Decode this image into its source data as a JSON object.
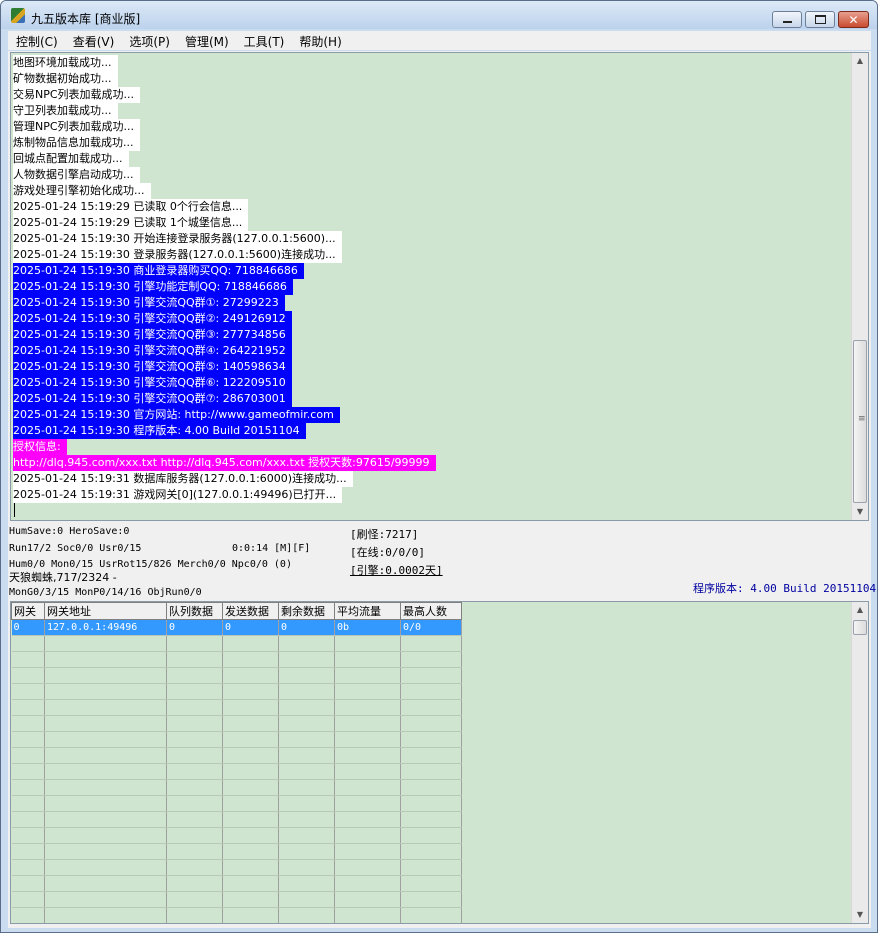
{
  "window": {
    "title": "九五版本库 [商业版]"
  },
  "menu": [
    "控制(C)",
    "查看(V)",
    "选项(P)",
    "管理(M)",
    "工具(T)",
    "帮助(H)"
  ],
  "log": [
    {
      "style": "normal",
      "text": "地图环境加载成功..."
    },
    {
      "style": "normal",
      "text": "矿物数据初始成功..."
    },
    {
      "style": "normal",
      "text": "交易NPC列表加载成功..."
    },
    {
      "style": "normal",
      "text": "守卫列表加载成功..."
    },
    {
      "style": "normal",
      "text": "管理NPC列表加载成功..."
    },
    {
      "style": "normal",
      "text": "炼制物品信息加载成功..."
    },
    {
      "style": "normal",
      "text": "回城点配置加载成功..."
    },
    {
      "style": "normal",
      "text": "人物数据引擎启动成功..."
    },
    {
      "style": "normal",
      "text": "游戏处理引擎初始化成功..."
    },
    {
      "style": "normal",
      "text": "2025-01-24 15:19:29 已读取 0个行会信息..."
    },
    {
      "style": "normal",
      "text": "2025-01-24 15:19:29 已读取 1个城堡信息..."
    },
    {
      "style": "normal",
      "text": "2025-01-24 15:19:30 开始连接登录服务器(127.0.0.1:5600)..."
    },
    {
      "style": "normal",
      "text": "2025-01-24 15:19:30 登录服务器(127.0.0.1:5600)连接成功..."
    },
    {
      "style": "blue",
      "text": "2025-01-24 15:19:30 商业登录器购买QQ: 718846686"
    },
    {
      "style": "blue",
      "text": "2025-01-24 15:19:30 引擎功能定制QQ: 718846686"
    },
    {
      "style": "blue",
      "text": "2025-01-24 15:19:30 引擎交流QQ群①: 27299223"
    },
    {
      "style": "blue",
      "text": "2025-01-24 15:19:30 引擎交流QQ群②: 249126912"
    },
    {
      "style": "blue",
      "text": "2025-01-24 15:19:30 引擎交流QQ群③: 277734856"
    },
    {
      "style": "blue",
      "text": "2025-01-24 15:19:30 引擎交流QQ群④: 264221952"
    },
    {
      "style": "blue",
      "text": "2025-01-24 15:19:30 引擎交流QQ群⑤: 140598634"
    },
    {
      "style": "blue",
      "text": "2025-01-24 15:19:30 引擎交流QQ群⑥: 122209510"
    },
    {
      "style": "blue",
      "text": "2025-01-24 15:19:30 引擎交流QQ群⑦: 286703001"
    },
    {
      "style": "blue",
      "text": "2025-01-24 15:19:30 官方网站: http://www.gameofmir.com"
    },
    {
      "style": "blue",
      "text": "2025-01-24 15:19:30 程序版本: 4.00 Build 20151104"
    },
    {
      "style": "magenta",
      "text": "授权信息:"
    },
    {
      "style": "magenta",
      "text": "http://dlq.945.com/xxx.txt http://dlq.945.com/xxx.txt 授权天数:97615/99999"
    },
    {
      "style": "normal",
      "text": "2025-01-24 15:19:31 数据库服务器(127.0.0.1:6000)连接成功..."
    },
    {
      "style": "normal",
      "text": "2025-01-24 15:19:31 游戏网关[0](127.0.0.1:49496)已打开..."
    }
  ],
  "status": {
    "hum_save": "HumSave:0 HeroSave:0",
    "run": "Run17/2 Soc0/0 Usr0/15",
    "time": "0:0:14 [M][F]",
    "mon": "Hum0/0 Mon0/15 UsrRot15/826 Merch0/0 Npc0/0 (0)",
    "spider": "天狼蜘蛛,717/2324 -",
    "mong": "MonG0/3/15 MonP0/14/16 ObjRun0/0",
    "refresh": "[刷怪:7217]",
    "online": "[在线:0/0/0]",
    "engine": "[引擎:0.0002天]",
    "version": "程序版本: 4.00 Build 20151104"
  },
  "gateway_table": {
    "headers": [
      "网关",
      "网关地址",
      "队列数据",
      "发送数据",
      "剩余数据",
      "平均流量",
      "最高人数"
    ],
    "rows": [
      [
        "0",
        "127.0.0.1:49496",
        "0",
        "0",
        "0",
        "0b",
        "0/0"
      ]
    ]
  }
}
